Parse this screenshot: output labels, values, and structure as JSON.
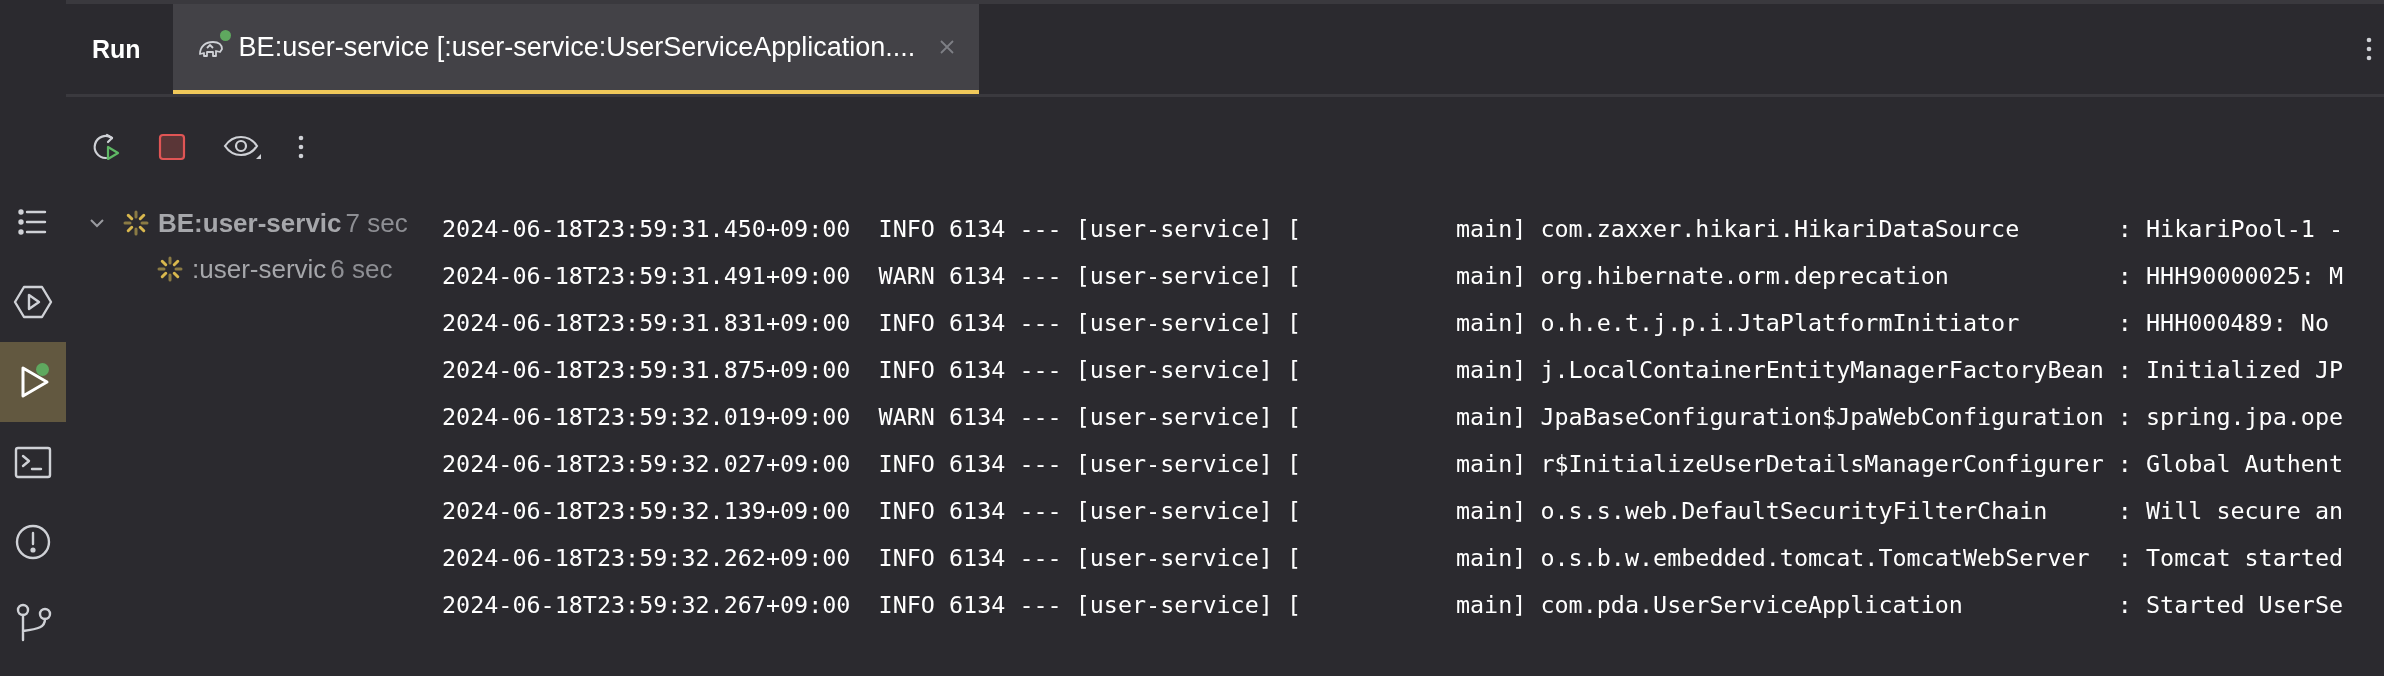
{
  "tool_window": {
    "title": "Run"
  },
  "tabs": [
    {
      "label": "BE:user-service [:user-service:UserServiceApplication....",
      "selected": true,
      "running": true
    }
  ],
  "rail": [
    {
      "kind": "structure",
      "selected": false,
      "running": false
    },
    {
      "kind": "services",
      "selected": false,
      "running": false
    },
    {
      "kind": "run",
      "selected": true,
      "running": true
    },
    {
      "kind": "terminal",
      "selected": false,
      "running": false
    },
    {
      "kind": "problems",
      "selected": false,
      "running": false
    },
    {
      "kind": "git",
      "selected": false,
      "running": false
    }
  ],
  "toolbar": [
    {
      "kind": "rerun"
    },
    {
      "kind": "stop"
    },
    {
      "kind": "view"
    },
    {
      "kind": "more"
    }
  ],
  "tree": [
    {
      "label": "BE:user-servic",
      "time": "7 sec",
      "expanded": true,
      "children": [
        {
          "label": ":user-servic",
          "time": "6 sec"
        }
      ]
    }
  ],
  "log_lines": [
    "2024-06-18T23:59:31.450+09:00  INFO 6134 --- [user-service] [           main] com.zaxxer.hikari.HikariDataSource       : HikariPool-1 -",
    "2024-06-18T23:59:31.491+09:00  WARN 6134 --- [user-service] [           main] org.hibernate.orm.deprecation            : HHH90000025: M",
    "2024-06-18T23:59:31.831+09:00  INFO 6134 --- [user-service] [           main] o.h.e.t.j.p.i.JtaPlatformInitiator       : HHH000489: No",
    "2024-06-18T23:59:31.875+09:00  INFO 6134 --- [user-service] [           main] j.LocalContainerEntityManagerFactoryBean : Initialized JP",
    "2024-06-18T23:59:32.019+09:00  WARN 6134 --- [user-service] [           main] JpaBaseConfiguration$JpaWebConfiguration : spring.jpa.ope",
    "2024-06-18T23:59:32.027+09:00  INFO 6134 --- [user-service] [           main] r$InitializeUserDetailsManagerConfigurer : Global Authent",
    "2024-06-18T23:59:32.139+09:00  INFO 6134 --- [user-service] [           main] o.s.s.web.DefaultSecurityFilterChain     : Will secure an",
    "2024-06-18T23:59:32.262+09:00  INFO 6134 --- [user-service] [           main] o.s.b.w.embedded.tomcat.TomcatWebServer  : Tomcat started",
    "2024-06-18T23:59:32.267+09:00  INFO 6134 --- [user-service] [           main] com.pda.UserServiceApplication           : Started UserSe"
  ]
}
